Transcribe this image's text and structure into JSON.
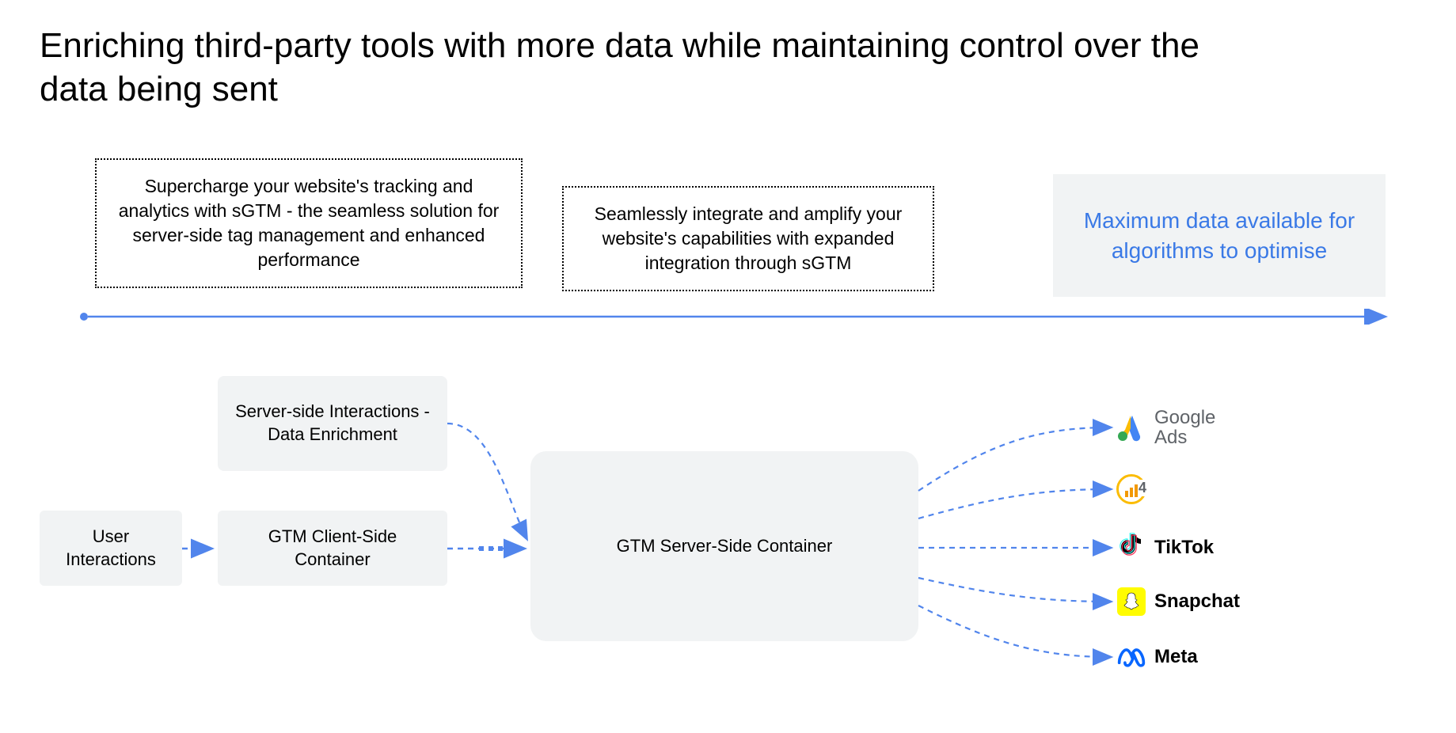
{
  "title": "Enriching third-party tools with more data while maintaining control over the data being sent",
  "callouts": {
    "one": "Supercharge your website's tracking and analytics with sGTM - the seamless solution for server-side tag management and enhanced performance",
    "two": "Seamlessly integrate and amplify your website's capabilities with expanded integration through sGTM"
  },
  "highlight": "Maximum data available for algorithms to optimise",
  "nodes": {
    "enrichment": "Server-side Interactions - Data Enrichment",
    "user": "User Interactions",
    "client": "GTM  Client-Side Container",
    "server": "GTM Server-Side Container"
  },
  "destinations": {
    "google_ads": "Google Ads",
    "ga4": "4",
    "tiktok": "TikTok",
    "snapchat": "Snapchat",
    "meta": "Meta"
  },
  "colors": {
    "accent_blue": "#5185ec",
    "grey_box": "#f1f3f4"
  }
}
